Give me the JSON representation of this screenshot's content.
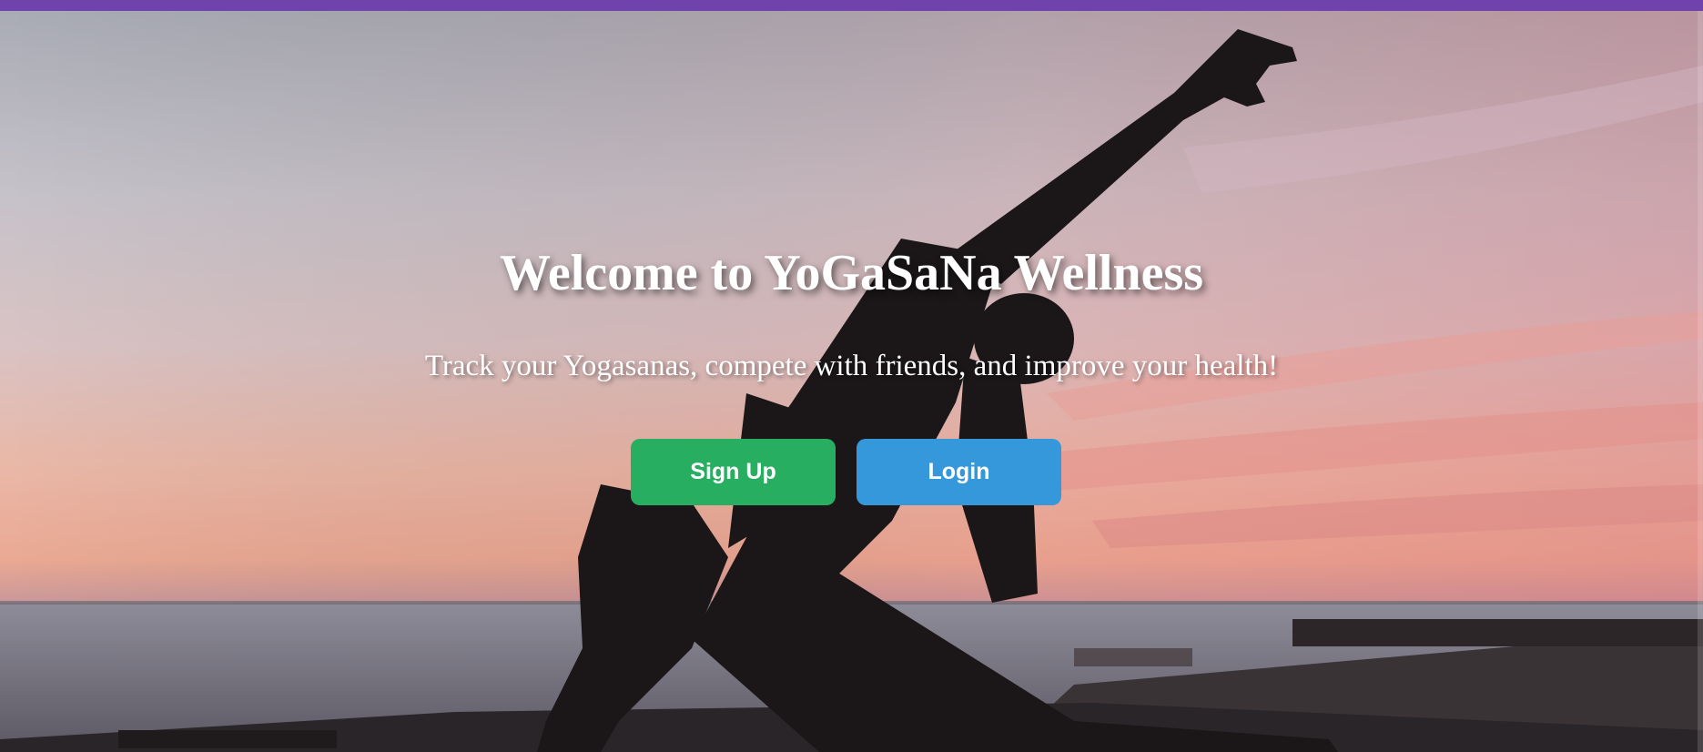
{
  "header": {
    "accent_color": "#6f42ac"
  },
  "hero": {
    "title": "Welcome to YoGaSaNa Wellness",
    "subtitle": "Track your Yogasanas, compete with friends, and improve your health!",
    "background_description_icon": "yoga-silhouette-sunset-image"
  },
  "actions": {
    "signup_label": "Sign Up",
    "signup_color": "#27ae60",
    "login_label": "Login",
    "login_color": "#3498db"
  }
}
